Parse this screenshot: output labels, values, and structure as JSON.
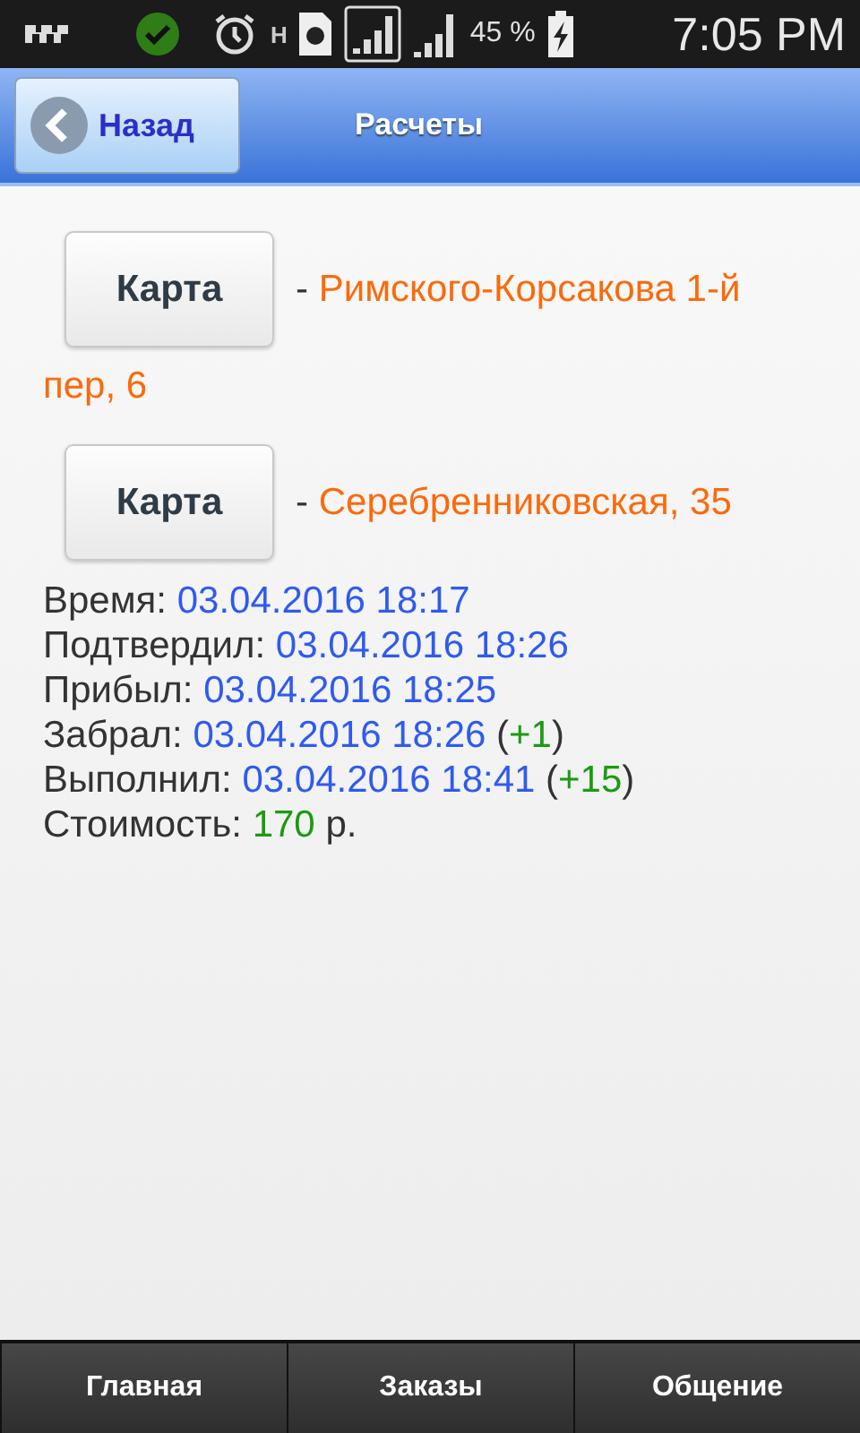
{
  "status_bar": {
    "network_type": "H",
    "battery": "45 %",
    "time": "7:05 PM"
  },
  "header": {
    "back_button": "Назад",
    "title": "Расчеты"
  },
  "addresses": [
    {
      "button": "Карта",
      "dash": "-",
      "address": [
        "Римского-Корсакова 1-й",
        "пер, 6"
      ]
    },
    {
      "button": "Карта",
      "dash": "-",
      "address": [
        "Серебренниковская, 35"
      ]
    }
  ],
  "details": [
    {
      "segments": [
        {
          "kind": "label",
          "text": "Время:"
        },
        {
          "kind": "date",
          "text": "03.04.2016 18:17"
        }
      ]
    },
    {
      "segments": [
        {
          "kind": "label",
          "text": "Подтвердил:"
        },
        {
          "kind": "date",
          "text": "03.04.2016 18:26"
        }
      ]
    },
    {
      "segments": [
        {
          "kind": "label",
          "text": "Прибыл:"
        },
        {
          "kind": "date",
          "text": "03.04.2016 18:25"
        }
      ]
    },
    {
      "segments": [
        {
          "kind": "label",
          "text": "Забрал:"
        },
        {
          "kind": "date",
          "text": "03.04.2016 18:26"
        },
        {
          "kind": "plain",
          "text": "("
        },
        {
          "kind": "green",
          "text": "+1"
        },
        {
          "kind": "plain",
          "text": ")"
        }
      ]
    },
    {
      "segments": [
        {
          "kind": "label",
          "text": "Выполнил:"
        },
        {
          "kind": "date",
          "text": "03.04.2016 18:41"
        },
        {
          "kind": "plain",
          "text": "("
        },
        {
          "kind": "green",
          "text": "+15"
        },
        {
          "kind": "plain",
          "text": ")"
        }
      ]
    },
    {
      "segments": [
        {
          "kind": "label",
          "text": "Стоимость:"
        },
        {
          "kind": "green",
          "text": "170"
        },
        {
          "kind": "plain",
          "text": "р."
        }
      ]
    }
  ],
  "nav": [
    "Главная",
    "Заказы",
    "Общение"
  ]
}
